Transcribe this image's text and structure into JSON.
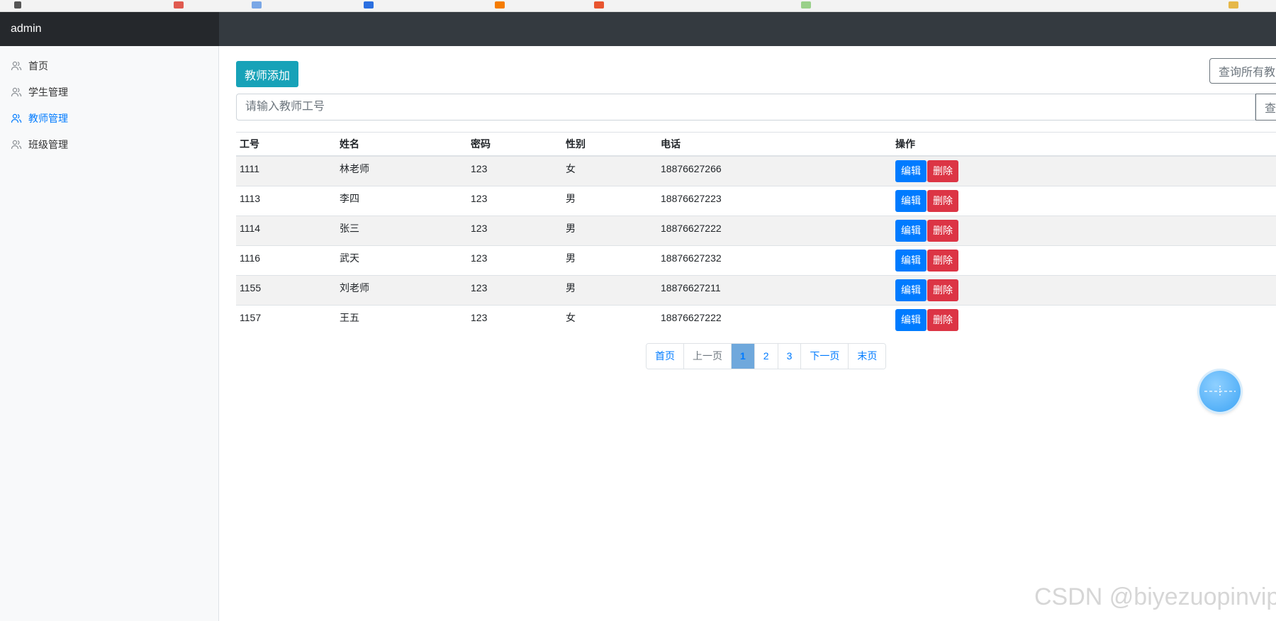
{
  "app": {
    "brand": "admin"
  },
  "sidebar": {
    "items": [
      {
        "label": "首页",
        "active": false
      },
      {
        "label": "学生管理",
        "active": false
      },
      {
        "label": "教师管理",
        "active": true
      },
      {
        "label": "班级管理",
        "active": false
      }
    ]
  },
  "toolbar": {
    "add_label": "教师添加",
    "query_all_label": "查询所有教",
    "search_placeholder": "请输入教师工号",
    "search_button_label": "查"
  },
  "table": {
    "headers": [
      "工号",
      "姓名",
      "密码",
      "性别",
      "电话",
      "操作"
    ],
    "edit_label": "编辑",
    "delete_label": "删除",
    "rows": [
      {
        "id": "1111",
        "name": "林老师",
        "password": "123",
        "gender": "女",
        "phone": "18876627266"
      },
      {
        "id": "1113",
        "name": "李四",
        "password": "123",
        "gender": "男",
        "phone": "18876627223"
      },
      {
        "id": "1114",
        "name": "张三",
        "password": "123",
        "gender": "男",
        "phone": "18876627222"
      },
      {
        "id": "1116",
        "name": "武天",
        "password": "123",
        "gender": "男",
        "phone": "18876627232"
      },
      {
        "id": "1155",
        "name": "刘老师",
        "password": "123",
        "gender": "男",
        "phone": "18876627211"
      },
      {
        "id": "1157",
        "name": "王五",
        "password": "123",
        "gender": "女",
        "phone": "18876627222"
      }
    ]
  },
  "pagination": {
    "first": "首页",
    "prev": "上一页",
    "pages": [
      "1",
      "2",
      "3"
    ],
    "current": "1",
    "next": "下一页",
    "last": "末页"
  },
  "watermark": "CSDN @biyezuopinvip",
  "colors": {
    "topbar": "#343a40",
    "brand_bg": "#25282c",
    "active_nav": "#007bff",
    "add_button": "#17a2b8",
    "edit_button": "#007bff",
    "delete_button": "#dc3545"
  }
}
